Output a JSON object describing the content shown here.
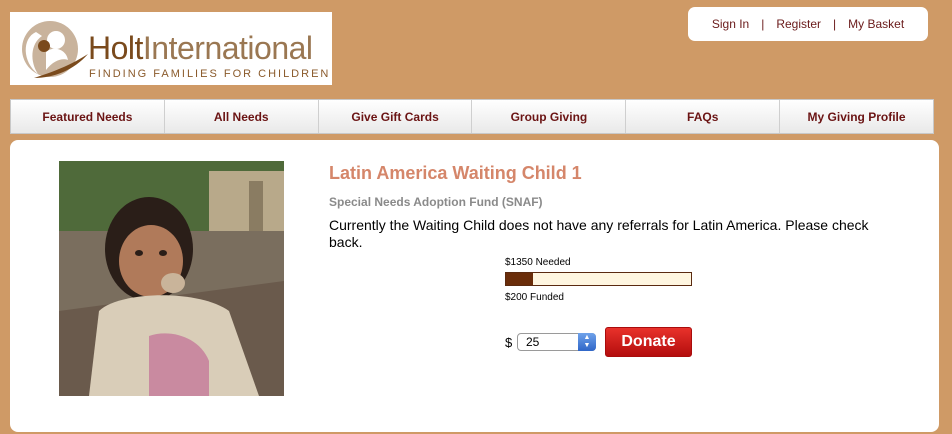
{
  "logo": {
    "name_bold": "Holt",
    "name_light": "International",
    "tagline": "FINDING FAMILIES FOR CHILDREN"
  },
  "account": {
    "sign_in": "Sign In",
    "register": "Register",
    "basket": "My Basket",
    "separator": "|"
  },
  "nav": {
    "items": [
      {
        "label": "Featured Needs"
      },
      {
        "label": "All Needs"
      },
      {
        "label": "Give Gift Cards"
      },
      {
        "label": "Group Giving"
      },
      {
        "label": "FAQs"
      },
      {
        "label": "My Giving Profile"
      }
    ]
  },
  "need": {
    "title": "Latin America Waiting Child 1",
    "fund": "Special Needs Adoption Fund (SNAF)",
    "description": "Currently the Waiting Child does not have any referrals for Latin America. Please check back.",
    "needed": "$1350 Needed",
    "funded": "$200 Funded",
    "funded_fraction": 0.148
  },
  "donate": {
    "currency": "$",
    "amount": "25",
    "button": "Donate"
  },
  "colors": {
    "background": "#cf9a66",
    "nav_text": "#6b1414",
    "title": "#d5866a",
    "bar_fill": "#6a2d0a",
    "donate": "#d11f1a"
  }
}
